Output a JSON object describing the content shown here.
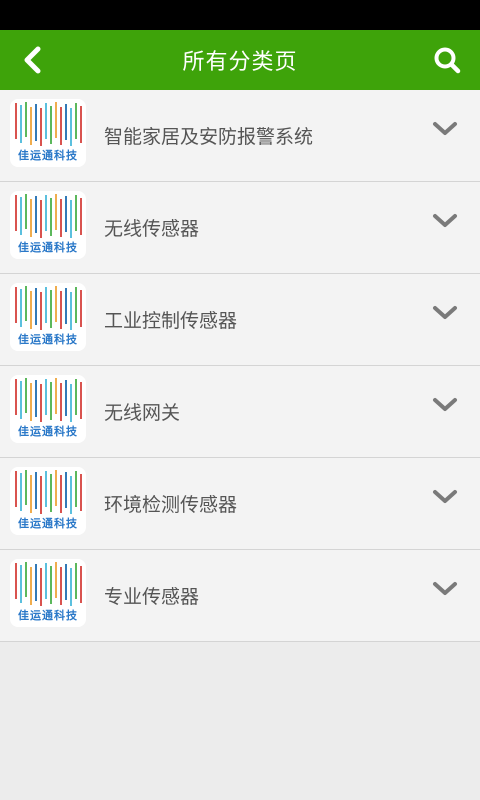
{
  "header": {
    "title": "所有分类页",
    "back_icon": "chevron-left-icon",
    "search_icon": "search-icon",
    "bg_color": "#3ea30a"
  },
  "categories": [
    {
      "label": "智能家居及安防报警系统",
      "brand": "佳运通科技"
    },
    {
      "label": "无线传感器",
      "brand": "佳运通科技"
    },
    {
      "label": "工业控制传感器",
      "brand": "佳运通科技"
    },
    {
      "label": "无线网关",
      "brand": "佳运通科技"
    },
    {
      "label": "环境检测传感器",
      "brand": "佳运通科技"
    },
    {
      "label": "专业传感器",
      "brand": "佳运通科技"
    }
  ]
}
